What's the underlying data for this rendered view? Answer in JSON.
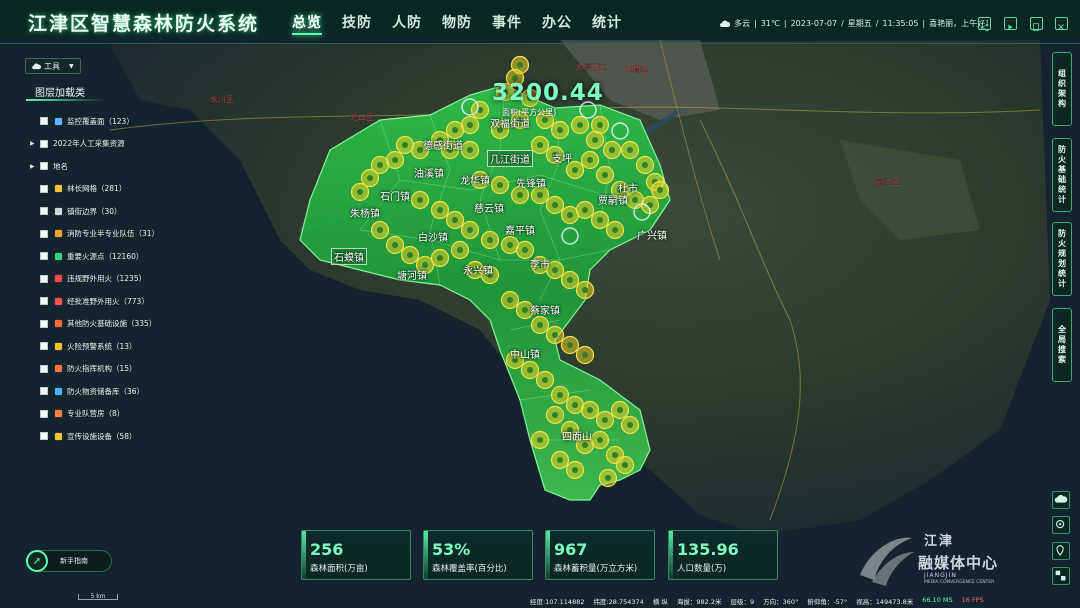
{
  "app": {
    "title": "江津区智慧森林防火系统"
  },
  "nav": [
    {
      "label": "总览",
      "active": true
    },
    {
      "label": "技防",
      "active": false
    },
    {
      "label": "人防",
      "active": false
    },
    {
      "label": "物防",
      "active": false
    },
    {
      "label": "事件",
      "active": false
    },
    {
      "label": "办公",
      "active": false
    },
    {
      "label": "统计",
      "active": false
    }
  ],
  "status": {
    "weather": "多云",
    "temperature": "31℃",
    "date": "2023-07-07",
    "weekday": "星期五",
    "time": "11:35:05",
    "greeting": "喜艳丽，上午好！"
  },
  "header_buttons": [
    "share-icon",
    "play-icon",
    "file-icon",
    "close-icon"
  ],
  "tools": {
    "label": "工具"
  },
  "layers": {
    "title": "图层加载类",
    "items": [
      {
        "label": "监控覆盖面（123）",
        "expandable": false,
        "icon": "camera-icon",
        "color": "#5fb8ff"
      },
      {
        "label": "2022年人工采集资源",
        "expandable": true,
        "icon": "",
        "color": ""
      },
      {
        "label": "地名",
        "expandable": true,
        "icon": "",
        "color": ""
      },
      {
        "label": "林长网格（281）",
        "expandable": false,
        "icon": "grid-icon",
        "color": "#f2c230"
      },
      {
        "label": "镇街边界（30）",
        "expandable": false,
        "icon": "boundary-icon",
        "color": "#cfd8d6"
      },
      {
        "label": "消防专业半专业队伍（31）",
        "expandable": false,
        "icon": "team-icon",
        "color": "#f2a030"
      },
      {
        "label": "重要火源点（12160）",
        "expandable": false,
        "icon": "fire-point-icon",
        "color": "#3fd07a"
      },
      {
        "label": "违规野外用火（1235）",
        "expandable": false,
        "icon": "warning-icon",
        "color": "#ff4a4a"
      },
      {
        "label": "经批准野外用火（773）",
        "expandable": false,
        "icon": "flame-icon",
        "color": "#ff5050"
      },
      {
        "label": "其他防火基础设施（335）",
        "expandable": false,
        "icon": "facility-icon",
        "color": "#ff6a3a"
      },
      {
        "label": "火险预警系统（13）",
        "expandable": false,
        "icon": "alarm-icon",
        "color": "#f2c230"
      },
      {
        "label": "防火指挥机构（15）",
        "expandable": false,
        "icon": "command-icon",
        "color": "#ff7040"
      },
      {
        "label": "防火物资储备库（36）",
        "expandable": false,
        "icon": "warehouse-icon",
        "color": "#4fb0ff"
      },
      {
        "label": "专业队营房（8）",
        "expandable": false,
        "icon": "barracks-icon",
        "color": "#ff8040"
      },
      {
        "label": "宣传设施设备（58）",
        "expandable": false,
        "icon": "broadcast-icon",
        "color": "#f2c230"
      }
    ]
  },
  "side_tabs": [
    "组织架构",
    "防火基础统计",
    "防火规划统计",
    "全局搜索"
  ],
  "map_tools": [
    "cloud-icon",
    "camera-icon",
    "location-icon",
    "layers-icon"
  ],
  "map": {
    "area_value": "3200.44",
    "area_label": "面积(平方公里)",
    "towns": [
      "石门镇",
      "油溪镇",
      "龙华镇",
      "几江街道",
      "先锋镇",
      "朱杨镇",
      "白沙镇",
      "慈云镇",
      "石蟆镇",
      "广兴镇",
      "塘河镇",
      "永兴镇",
      "嘉平镇",
      "支坪",
      "贾嗣镇",
      "杜市",
      "蔡家镇",
      "中山镇",
      "四面山",
      "李市",
      "双福街道",
      "德感街道"
    ],
    "city_labels": [
      "元山区",
      "大渡口区",
      "巴南区",
      "永川区",
      "綦江区"
    ]
  },
  "stats": [
    {
      "value": "256",
      "label": "森林面积(万亩)"
    },
    {
      "value": "53%",
      "label": "森林覆盖率(百分比)"
    },
    {
      "value": "967",
      "label": "森林蓄积量(万立方米)"
    },
    {
      "value": "135.96",
      "label": "人口数量(万)"
    }
  ],
  "newbie": {
    "label": "新手指南"
  },
  "scale": "5 km",
  "statusbar": {
    "lng": "经度:107.114882",
    "lat": "纬度:28.754374",
    "grid": "横 纵",
    "altitude": "海拔：982.2米",
    "level": "层级：9",
    "heading": "方向：360°",
    "pitch": "俯仰角：-57°",
    "view_height": "视高：149473.8米",
    "latency": "66.10 MS",
    "fps": "16 FPS"
  },
  "watermark": {
    "line1": "江津",
    "line2": "融媒体中心",
    "line3": "JIANGJIN",
    "line4": "MEDIA CONVERGENCE CENTER"
  }
}
